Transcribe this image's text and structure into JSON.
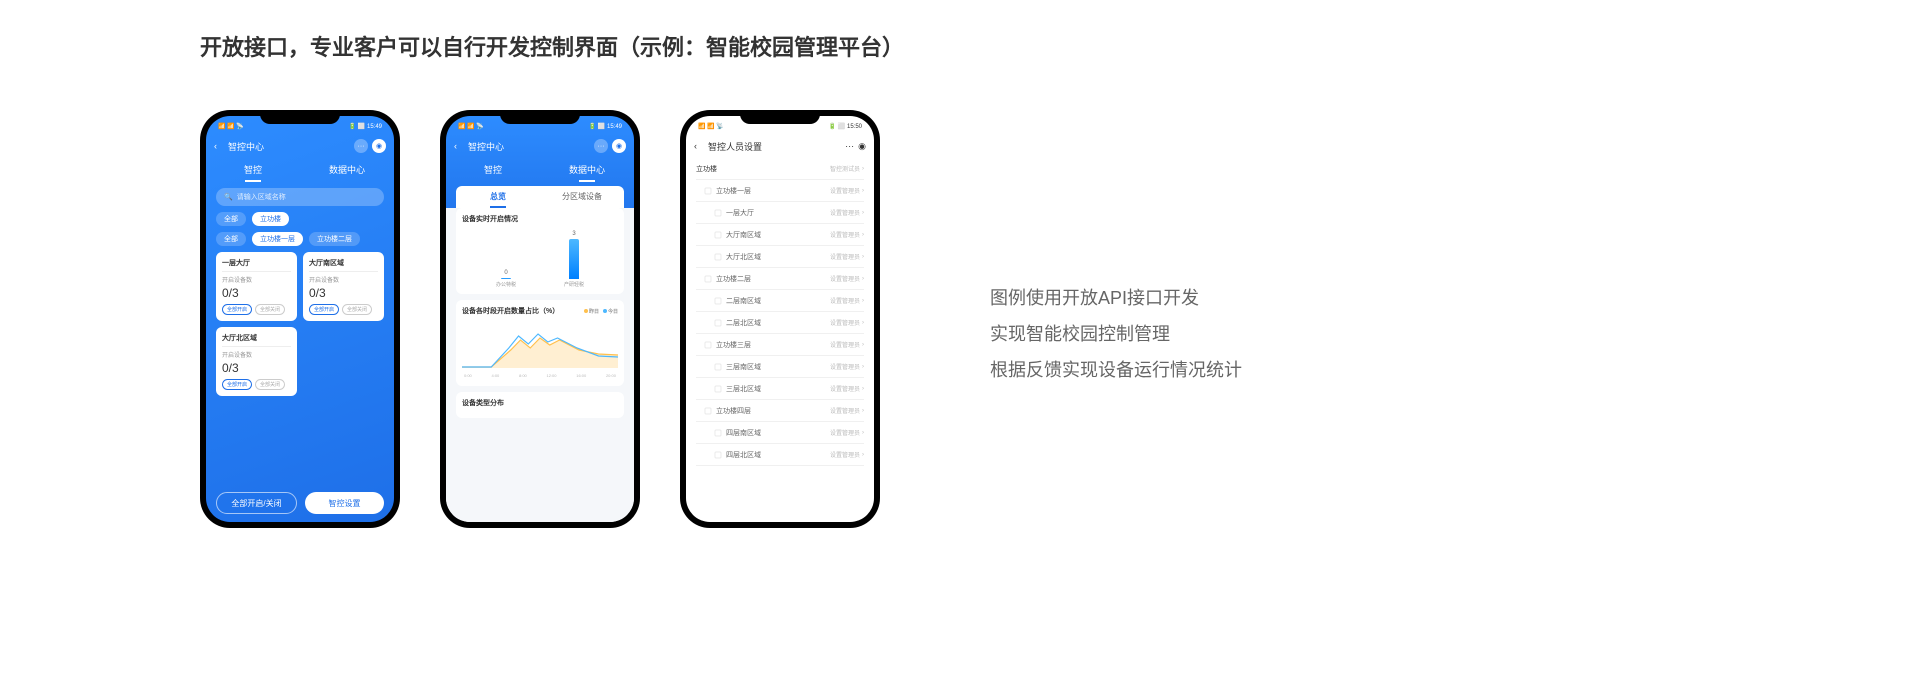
{
  "page_title": "开放接口，专业客户可以自行开发控制界面（示例：智能校园管理平台）",
  "description": [
    "图例使用开放API接口开发",
    "实现智能校园控制管理",
    "根据反馈实现设备运行情况统计"
  ],
  "status": {
    "left": "📶 📶 📡",
    "right_1": "🔋 ⬜ 15:49",
    "right_3": "🔋 ⬜ 15:50"
  },
  "screen1": {
    "nav_title": "智控中心",
    "tabs": [
      "智控",
      "数据中心"
    ],
    "search_placeholder": "请输入区域名称",
    "chips_row1": [
      "全部",
      "立功楼"
    ],
    "chips_row2": [
      "全部",
      "立功楼一层",
      "立功楼二层"
    ],
    "cards": [
      {
        "title": "一层大厅",
        "sub": "开启设备数",
        "count": "0/3",
        "btn1": "全部开启",
        "btn2": "全部关闭"
      },
      {
        "title": "大厅南区域",
        "sub": "开启设备数",
        "count": "0/3",
        "btn1": "全部开启",
        "btn2": "全部关闭"
      },
      {
        "title": "大厅北区域",
        "sub": "开启设备数",
        "count": "0/3",
        "btn1": "全部开启",
        "btn2": "全部关闭"
      }
    ],
    "footer_btn1": "全部开启/关闭",
    "footer_btn2": "智控设置"
  },
  "screen2": {
    "nav_title": "智控中心",
    "tabs": [
      "智控",
      "数据中心"
    ],
    "subtabs": [
      "总览",
      "分区域设备"
    ],
    "panel1_title": "设备实时开启情况",
    "panel2_title": "设备各时段开启数量占比（%）",
    "legend": [
      {
        "label": "昨日",
        "color": "#ffc04d"
      },
      {
        "label": "今日",
        "color": "#4db8ff"
      }
    ],
    "panel3_title": "设备类型分布"
  },
  "chart_data": [
    {
      "type": "bar",
      "title": "设备实时开启情况",
      "categories": [
        "办公特税",
        "产研轻税"
      ],
      "values": [
        0,
        3
      ],
      "ylim": [
        0,
        3
      ]
    },
    {
      "type": "line",
      "title": "设备各时段开启数量占比（%）",
      "x": [
        "0:00",
        "4:00",
        "8:00",
        "12:00",
        "16:00",
        "20:00"
      ],
      "series": [
        {
          "name": "昨日",
          "color": "#ffc04d",
          "values": [
            0,
            0,
            35,
            55,
            50,
            30
          ]
        },
        {
          "name": "今日",
          "color": "#4db8ff",
          "values": [
            0,
            0,
            40,
            60,
            45,
            25
          ]
        }
      ],
      "ylim": [
        0,
        100
      ]
    }
  ],
  "screen3": {
    "nav_title": "智控人员设置",
    "rows": [
      {
        "level": 1,
        "label": "立功楼",
        "role": "智控测试员"
      },
      {
        "level": 2,
        "label": "立功楼一层",
        "role": "设置管理员"
      },
      {
        "level": 3,
        "label": "一层大厅",
        "role": "设置管理员"
      },
      {
        "level": 3,
        "label": "大厅南区域",
        "role": "设置管理员"
      },
      {
        "level": 3,
        "label": "大厅北区域",
        "role": "设置管理员"
      },
      {
        "level": 2,
        "label": "立功楼二层",
        "role": "设置管理员"
      },
      {
        "level": 3,
        "label": "二层南区域",
        "role": "设置管理员"
      },
      {
        "level": 3,
        "label": "二层北区域",
        "role": "设置管理员"
      },
      {
        "level": 2,
        "label": "立功楼三层",
        "role": "设置管理员"
      },
      {
        "level": 3,
        "label": "三层南区域",
        "role": "设置管理员"
      },
      {
        "level": 3,
        "label": "三层北区域",
        "role": "设置管理员"
      },
      {
        "level": 2,
        "label": "立功楼四层",
        "role": "设置管理员"
      },
      {
        "level": 3,
        "label": "四层南区域",
        "role": "设置管理员"
      },
      {
        "level": 3,
        "label": "四层北区域",
        "role": "设置管理员"
      }
    ]
  }
}
